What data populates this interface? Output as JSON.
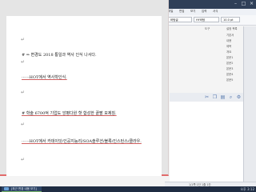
{
  "back_window": {
    "title": "",
    "menu": [
      "파일",
      "편집",
      "보기",
      "입력",
      "서식"
    ],
    "font_combos": [
      "바탕글",
      "HY바탕",
      "10.0 pt"
    ],
    "format_row_1": [
      "도구",
      "설정 목록"
    ],
    "side_list": [
      {
        "left": "",
        "right": "기본서"
      },
      {
        "left": "",
        "right": "내용"
      },
      {
        "left": "",
        "right": "제목"
      },
      {
        "left": "",
        "right": "개요"
      },
      {
        "left": "",
        "right": "본문1"
      },
      {
        "left": "",
        "right": "본문2"
      },
      {
        "left": "",
        "right": "본문3"
      },
      {
        "left": "",
        "right": "본문4"
      },
      {
        "left": "",
        "right": "본문5"
      }
    ],
    "status_text": "1/1쪽  1단  1줄 1칸"
  },
  "document": {
    "lines": [
      {
        "text": "# ⇒ 변경도 2018 통일과 역사 인식 나서다."
      },
      {
        "text": "······HOT에서 역사학인식."
      },
      {
        "text": "# 학술 6700억 기업도 앙평다원 핫 합성한 끝팔 모제칭."
      },
      {
        "text": "······HOT에서 카데이잇/인공지능리/SOA솔루션/블록/인스턴스/클라우."
      }
    ]
  },
  "taskbar": {
    "task_label": "[최근 변경 내용 보기]",
    "tray_time": "오후 3:12"
  },
  "colors": {
    "taskbar": "#1f2c42",
    "window_title": "#2f3f58",
    "selection_border": "#e26b6b"
  }
}
